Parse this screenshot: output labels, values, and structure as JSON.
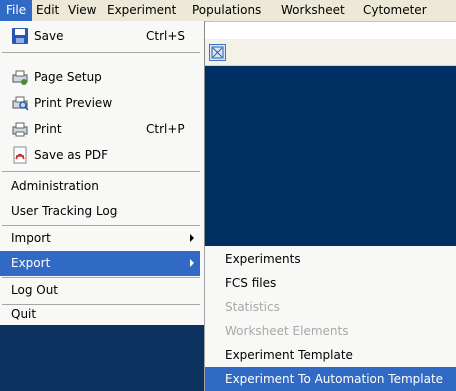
{
  "menubar": {
    "items": [
      "File",
      "Edit",
      "View",
      "Experiment",
      "Populations",
      "Worksheet",
      "Cytometer"
    ]
  },
  "file_menu": {
    "items": [
      {
        "label": "Save",
        "shortcut": "Ctrl+S",
        "icon": "floppy-disk-icon"
      },
      {
        "label": "Page Setup",
        "icon": "page-setup-icon"
      },
      {
        "label": "Print Preview",
        "icon": "print-preview-icon"
      },
      {
        "label": "Print",
        "shortcut": "Ctrl+P",
        "icon": "printer-icon"
      },
      {
        "label": "Save as PDF",
        "icon": "pdf-icon"
      },
      {
        "label": "Administration"
      },
      {
        "label": "User Tracking Log"
      },
      {
        "label": "Import",
        "submenu": true
      },
      {
        "label": "Export",
        "submenu": true,
        "selected": true
      },
      {
        "label": "Log Out"
      },
      {
        "label": "Quit"
      }
    ]
  },
  "export_submenu": {
    "items": [
      {
        "label": "Experiments",
        "enabled": true
      },
      {
        "label": "FCS files",
        "enabled": true
      },
      {
        "label": "Statistics",
        "enabled": false
      },
      {
        "label": "Worksheet Elements",
        "enabled": false
      },
      {
        "label": "Experiment Template",
        "enabled": true
      },
      {
        "label": "Experiment To Automation Template",
        "enabled": true,
        "selected": true
      }
    ]
  },
  "colors": {
    "highlight": "#316ac5",
    "workspace": "#002f63",
    "menubar": "#ece9d8"
  }
}
